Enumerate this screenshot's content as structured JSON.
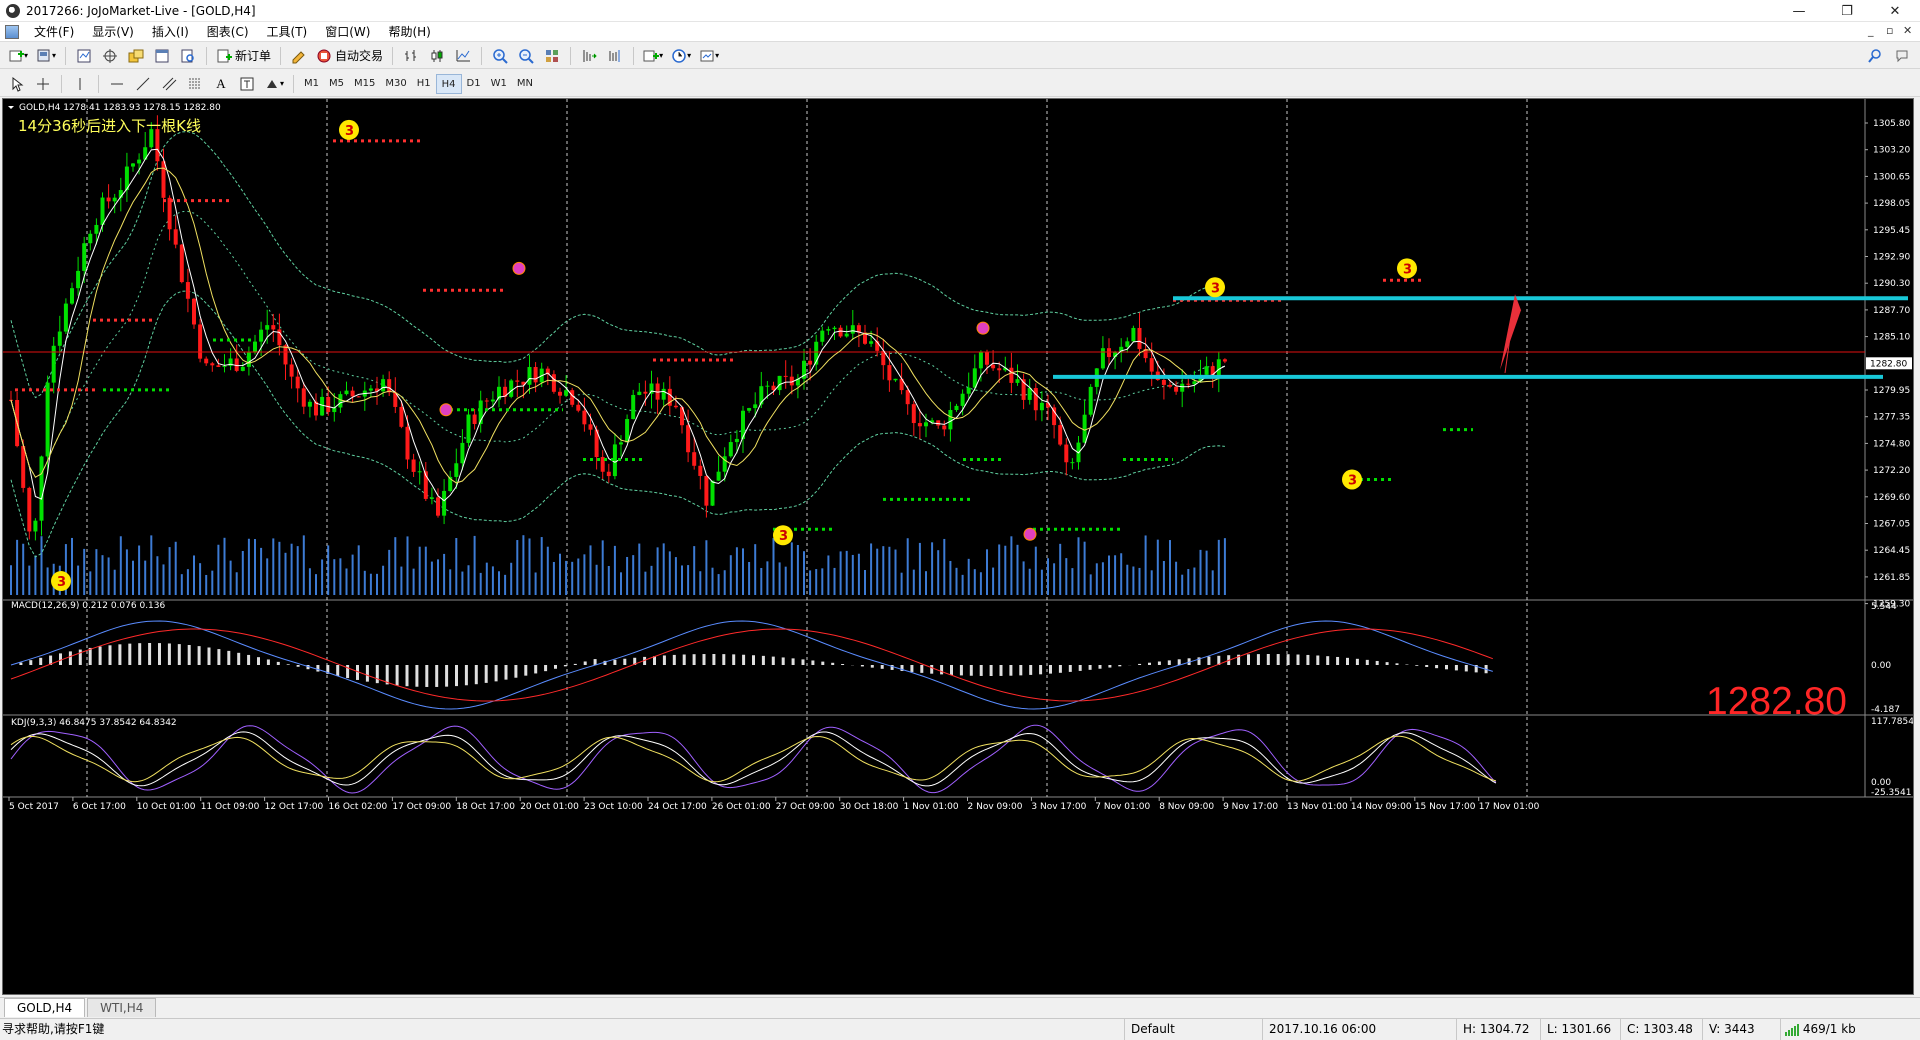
{
  "window": {
    "title": "2017266: JoJoMarket-Live - [GOLD,H4]",
    "minimize": "—",
    "restore": "❐",
    "close": "✕"
  },
  "menu": {
    "items": [
      "文件(F)",
      "显示(V)",
      "插入(I)",
      "图表(C)",
      "工具(T)",
      "窗口(W)",
      "帮助(H)"
    ],
    "mdi_min": "_",
    "mdi_restore": "▫",
    "mdi_close": "✕"
  },
  "toolbar": {
    "new_order": "新订单",
    "auto_trading": "自动交易",
    "timeframes": [
      "M1",
      "M5",
      "M15",
      "M30",
      "H1",
      "H4",
      "D1",
      "W1",
      "MN"
    ],
    "active_timeframe": "H4"
  },
  "chart": {
    "info": "GOLD,H4  1278.41 1283.93 1278.15 1282.80",
    "countdown": "14分36秒后进入下一根K线",
    "big_price": "1282.80",
    "current_price_label": "1282.80",
    "price_labels": [
      "1305.80",
      "1303.20",
      "1300.65",
      "1298.05",
      "1295.45",
      "1292.90",
      "1290.30",
      "1287.70",
      "1285.10",
      "1282.80",
      "1279.95",
      "1277.35",
      "1274.80",
      "1272.20",
      "1269.60",
      "1267.05",
      "1264.45",
      "1261.85",
      "1259.30"
    ],
    "date_labels": [
      "5 Oct 2017",
      "6 Oct 17:00",
      "10 Oct 01:00",
      "11 Oct 09:00",
      "12 Oct 17:00",
      "16 Oct 02:00",
      "17 Oct 09:00",
      "18 Oct 17:00",
      "20 Oct 01:00",
      "23 Oct 10:00",
      "24 Oct 17:00",
      "26 Oct 01:00",
      "27 Oct 09:00",
      "30 Oct 18:00",
      "1 Nov 01:00",
      "2 Nov 09:00",
      "3 Nov 17:00",
      "7 Nov 01:00",
      "8 Nov 09:00",
      "9 Nov 17:00",
      "13 Nov 01:00",
      "14 Nov 09:00",
      "15 Nov 17:00",
      "17 Nov 01:00"
    ],
    "marker_label": "3",
    "colors": {
      "bull": "#00e000",
      "bear": "#ff1a1a",
      "cyan_line": "#18c8d8",
      "grid": "#c8c8c8"
    }
  },
  "macd": {
    "label": "MACD(12,26,9) 0.212 0.076 0.136",
    "scale": [
      "5.544",
      "0.00",
      "-4.187"
    ]
  },
  "kdj": {
    "label": "KDJ(9,3,3) 46.8475 37.8542 64.8342",
    "scale": [
      "117.7854",
      "0.00",
      "-25.3541"
    ]
  },
  "tabs": [
    "GOLD,H4",
    "WTI,H4"
  ],
  "active_tab": "GOLD,H4",
  "status": {
    "help": "寻求帮助,请按F1键",
    "profile": "Default",
    "datetime": "2017.10.16 06:00",
    "high": "H: 1304.72",
    "low": "L: 1301.66",
    "close": "C: 1303.48",
    "volume": "V: 3443",
    "traffic": "469/1 kb"
  }
}
